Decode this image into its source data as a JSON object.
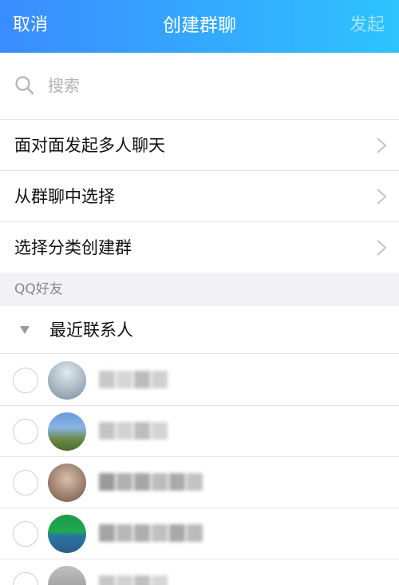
{
  "header": {
    "cancel": "取消",
    "title": "创建群聊",
    "start": "发起"
  },
  "search": {
    "placeholder": "搜索",
    "icon": "search-icon"
  },
  "options": [
    {
      "label": "面对面发起多人聊天"
    },
    {
      "label": "从群聊中选择"
    },
    {
      "label": "选择分类创建群"
    }
  ],
  "section": {
    "label": "QQ好友"
  },
  "group": {
    "label": "最近联系人"
  },
  "colors": {
    "header_start": "#3a8cff",
    "header_end": "#2ec3ff"
  }
}
